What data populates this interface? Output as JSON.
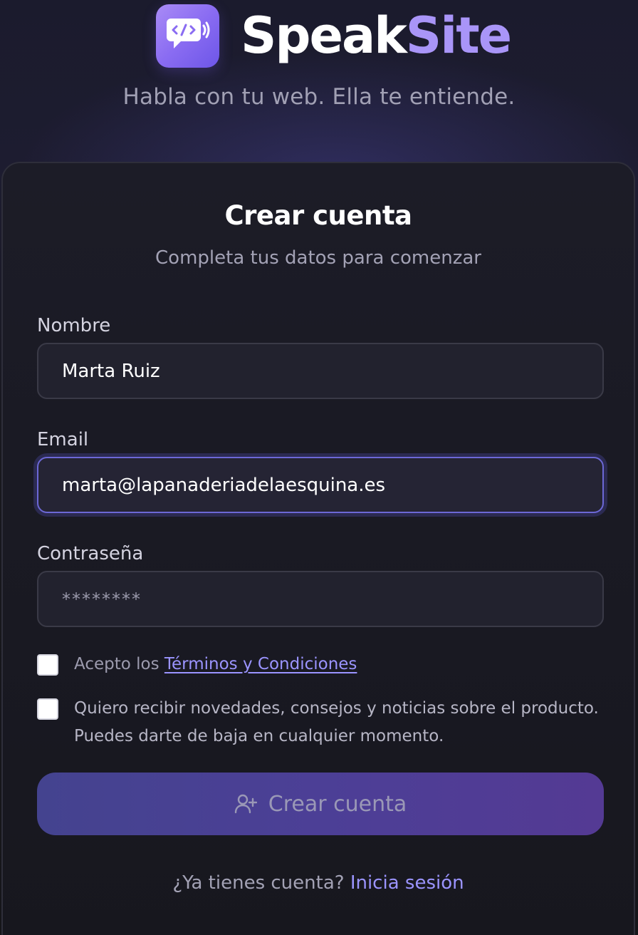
{
  "brand": {
    "name_part1": "Speak",
    "name_part2": "Site",
    "tagline": "Habla con tu web. Ella te entiende.",
    "accent_color": "#a995f8",
    "logo_icon": "chat-bubble-code-speaker-icon"
  },
  "card": {
    "title": "Crear cuenta",
    "subtitle": "Completa tus datos para comenzar"
  },
  "form": {
    "name": {
      "label": "Nombre",
      "value": "Marta Ruiz"
    },
    "email": {
      "label": "Email",
      "value": "marta@lapanaderiadelaesquina.es"
    },
    "password": {
      "label": "Contraseña",
      "masked_value": "********"
    },
    "terms": {
      "checked": false,
      "prefix": "Acepto los ",
      "link_text": "Términos y Condiciones"
    },
    "newsletter": {
      "checked": false,
      "line1": "Quiero recibir novedades, consejos y noticias sobre el producto.",
      "line2": "Puedes darte de baja en cualquier momento."
    },
    "submit": {
      "label": "Crear cuenta",
      "icon": "user-plus-icon",
      "enabled": false
    }
  },
  "footer": {
    "question": "¿Ya tienes cuenta? ",
    "login_link": "Inicia sesión",
    "link_color": "#9b94ff"
  }
}
